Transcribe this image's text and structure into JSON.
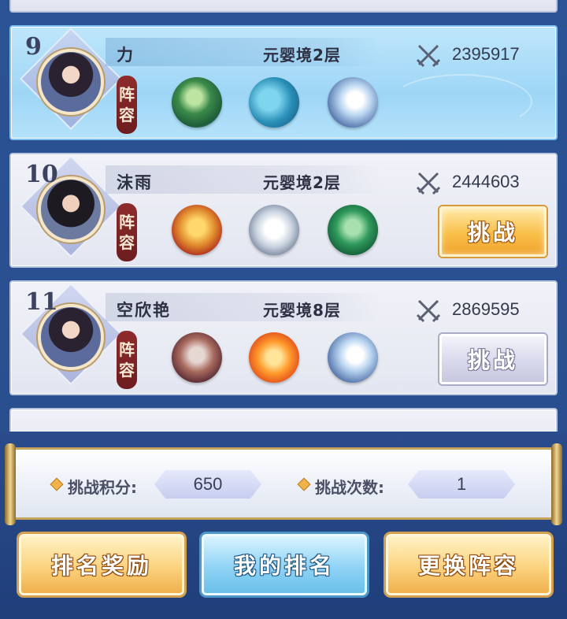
{
  "ranking_list": [
    {
      "rank": "9",
      "name": "力",
      "realm": "元婴境2层",
      "power": "2395917",
      "lineup_label_top": "阵",
      "lineup_label_bottom": "容",
      "is_self": true,
      "avatar": "female-avatar",
      "beasts": [
        "green-dragon",
        "whale",
        "white-dragon"
      ],
      "button": ""
    },
    {
      "rank": "10",
      "name": "沫雨",
      "realm": "元婴境2层",
      "power": "2444603",
      "lineup_label_top": "阵",
      "lineup_label_bottom": "容",
      "is_self": false,
      "avatar": "male-avatar",
      "beasts": [
        "golden-dragon",
        "white-tiger",
        "jade-dragon"
      ],
      "button": "挑战",
      "button_state": "active"
    },
    {
      "rank": "11",
      "name": "空欣艳",
      "realm": "元婴境8层",
      "power": "2869595",
      "lineup_label_top": "阵",
      "lineup_label_bottom": "容",
      "is_self": false,
      "avatar": "female-avatar",
      "beasts": [
        "qilin",
        "phoenix",
        "white-dragon"
      ],
      "button": "挑战",
      "button_state": "disabled"
    }
  ],
  "stats": {
    "score_label": "挑战积分:",
    "score_value": "650",
    "count_label": "挑战次数:",
    "count_value": "1"
  },
  "actions": {
    "reward_label": "排名奖励",
    "my_rank_label": "我的排名",
    "change_lineup_label": "更换阵容"
  },
  "colors": {
    "background": "#274a86",
    "self_card": "#9ed6f6",
    "gold_button": "#f9bf49",
    "blue_button": "#8fd3f5",
    "lineup_tag": "#8f2c2c"
  }
}
